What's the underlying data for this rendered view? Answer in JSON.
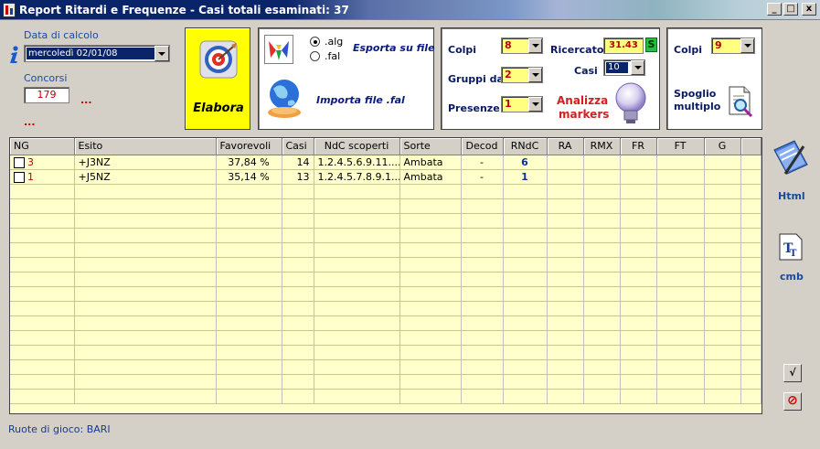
{
  "window": {
    "title": "Report Ritardi e Frequenze - Casi totali esaminati: 37",
    "min_label": "_",
    "max_label": "□",
    "close_label": "x"
  },
  "left": {
    "date_label": "Data di calcolo",
    "date_value": "mercoledì 02/01/08",
    "concorsi_label": "Concorsi",
    "concorsi_value": "179",
    "ellipsis_a": "...",
    "ellipsis_b": "..."
  },
  "elabora": {
    "label": "Elabora"
  },
  "file_panel": {
    "radio_alg": ".alg",
    "radio_fal": ".fal",
    "export_label": "Esporta su file",
    "import_label": "Importa file .fal"
  },
  "params": {
    "colpi_label": "Colpi",
    "colpi_value": "8",
    "gruppi_label": "Gruppi da",
    "gruppi_value": "2",
    "presenze_label": "Presenze",
    "presenze_value": "1",
    "ricercato_label": "Ricercato",
    "ricercato_value": "31.43",
    "s_label": "S",
    "casi_label": "Casi",
    "casi_value": "10",
    "analizza_label_1": "Analizza",
    "analizza_label_2": "markers"
  },
  "spoglio": {
    "colpi_label": "Colpi",
    "colpi_value": "9",
    "label_1": "Spoglio",
    "label_2": "multiplo"
  },
  "grid": {
    "columns": [
      "NG",
      "Esito",
      "Favorevoli",
      "Casi",
      "NdC scoperti",
      "Sorte",
      "Decod",
      "RNdC",
      "RA",
      "RMX",
      "FR",
      "FT",
      "G"
    ],
    "rows": [
      {
        "ng": "3",
        "esito": "+J3NZ",
        "favorevoli": "37,84 %",
        "casi": "14",
        "ndc": "1.2.4.5.6.9.11....",
        "sorte": "Ambata",
        "decod": "-",
        "rndc": "6"
      },
      {
        "ng": "1",
        "esito": "+J5NZ",
        "favorevoli": "35,14 %",
        "casi": "13",
        "ndc": "1.2.4.5.7.8.9.1...",
        "sorte": "Ambata",
        "decod": "-",
        "rndc": "1"
      }
    ]
  },
  "side": {
    "html_label": "Html",
    "cmb_label": "cmb",
    "check_label": "√",
    "cancel_label": "⊘"
  },
  "status": {
    "text": "Ruote di gioco: BARI"
  }
}
